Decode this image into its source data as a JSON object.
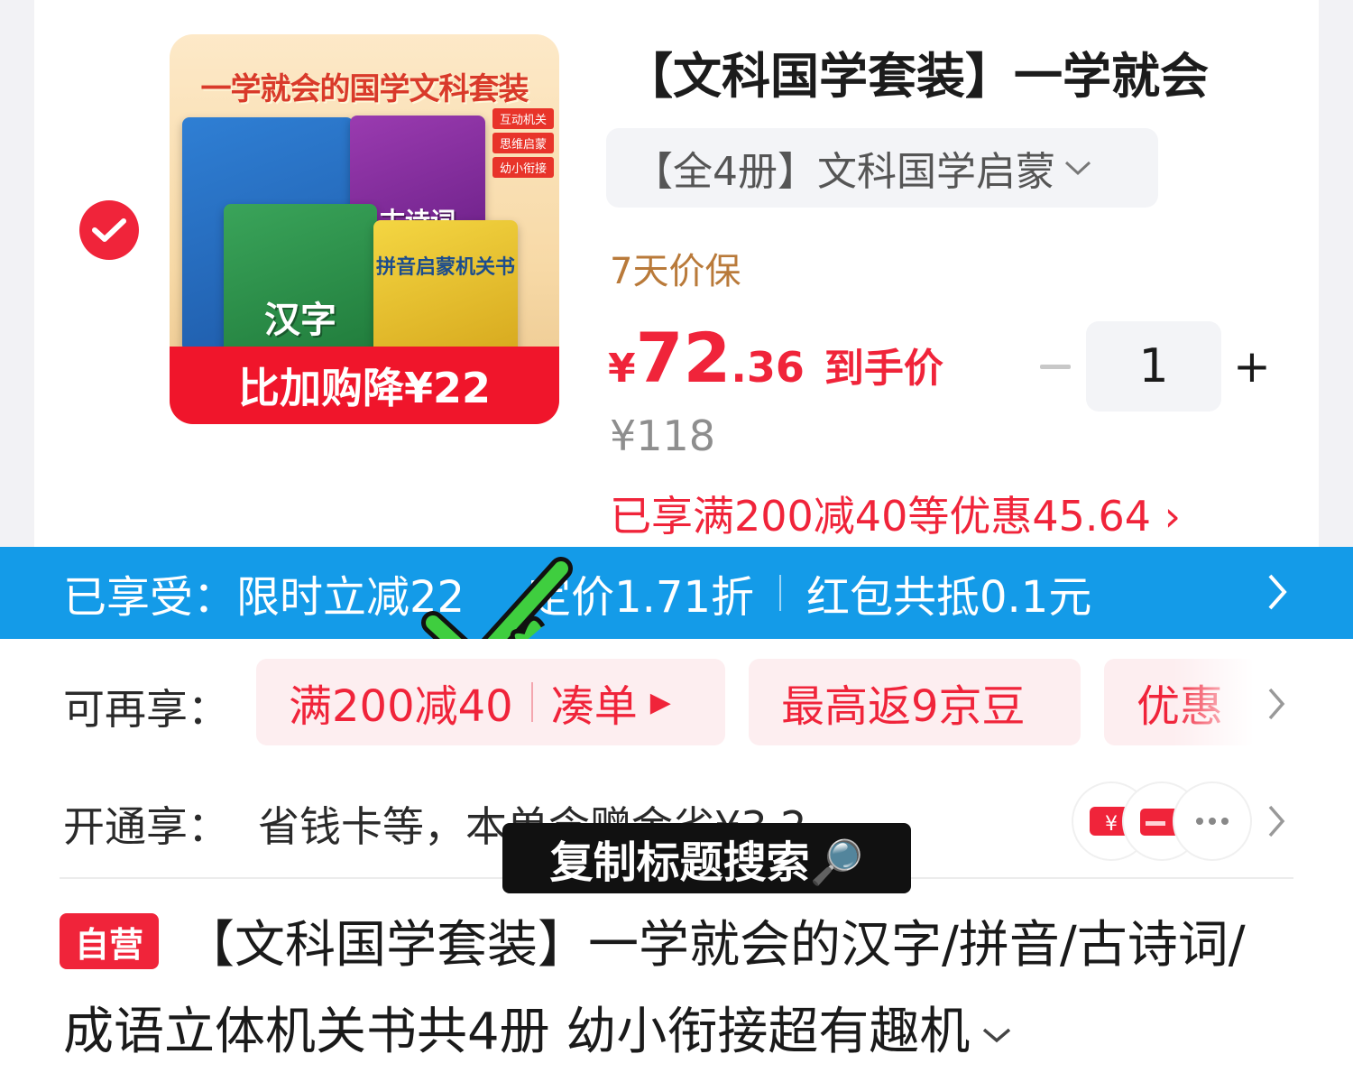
{
  "product": {
    "image_headline": "一学就会的国学文科套装",
    "image_tags": [
      "互动机关",
      "思维启蒙",
      "幼小衔接"
    ],
    "image_books": [
      "古诗词",
      "汉字",
      "拼音启蒙机关书"
    ],
    "image_promo": "比加购降¥22",
    "title": "【文科国学套装】一学就会",
    "variant": "【全4册】文科国学启蒙",
    "guarantee": "7天价保",
    "price": {
      "yen": "¥",
      "integer": "72",
      "decimal": ".36",
      "tag": "到手价"
    },
    "quantity": "1",
    "original_price": "¥118",
    "discount_line": "已享满200减40等优惠45.64 ›",
    "selected": true
  },
  "benefits_bar": {
    "prefix": "已享受：",
    "items": [
      "限时立减22",
      "定价1.71折",
      "红包共抵0.1元"
    ]
  },
  "extra_benefits": {
    "label": "可再享：",
    "chips": [
      {
        "main": "满200减40",
        "action": "凑单"
      },
      {
        "main": "最高返9京豆"
      },
      {
        "main": "优惠"
      }
    ]
  },
  "open_benefits": {
    "label": "开通享：",
    "text": "省钱卡等，本单含赠金省¥3.2"
  },
  "overlay": {
    "text": "复制标题搜索🔎"
  },
  "full_title": {
    "badge": "自营",
    "text": "【文科国学套装】一学就会的汉字/拼音/古诗词/成语立体机关书共4册 幼小衔接超有趣机"
  },
  "colors": {
    "accent_red": "#f0243a",
    "bar_blue": "#149be8",
    "gold": "#b97a3a"
  }
}
